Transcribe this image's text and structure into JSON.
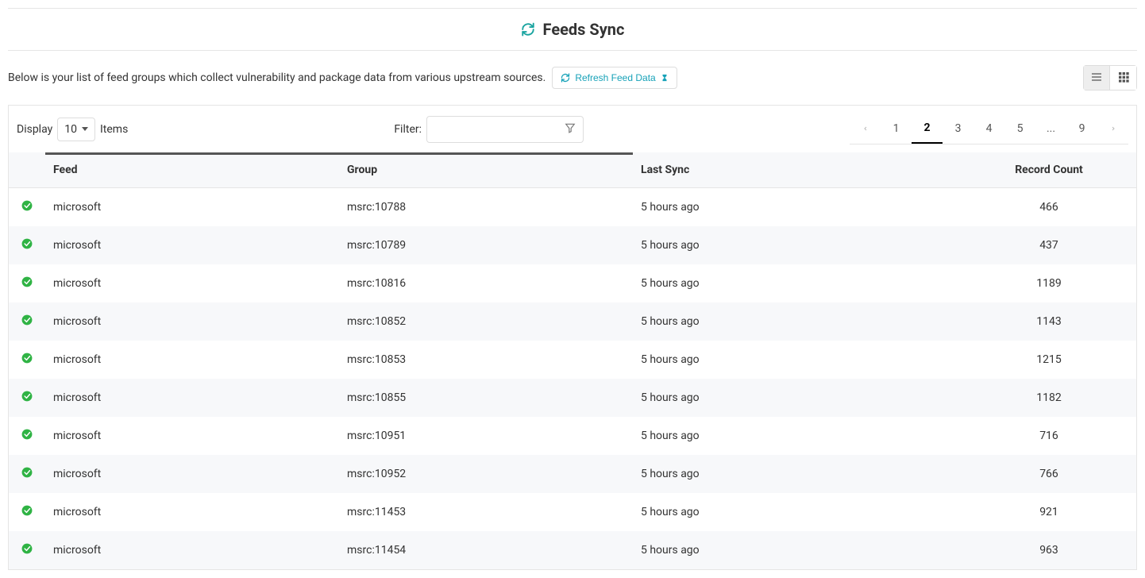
{
  "header": {
    "title": "Feeds Sync"
  },
  "subheader": {
    "description": "Below is your list of feed groups which collect vulnerability and package data from various upstream sources.",
    "refresh_label": "Refresh Feed Data"
  },
  "toolbar": {
    "display_label": "Display",
    "display_value": "10",
    "display_suffix": "Items",
    "filter_label": "Filter:",
    "filter_value": ""
  },
  "pagination": {
    "pages": [
      "1",
      "2",
      "3",
      "4",
      "5",
      "...",
      "9"
    ],
    "active": "2"
  },
  "table": {
    "headers": {
      "feed": "Feed",
      "group": "Group",
      "last_sync": "Last Sync",
      "record_count": "Record Count"
    },
    "rows": [
      {
        "feed": "microsoft",
        "group": "msrc:10788",
        "last_sync": "5 hours ago",
        "record_count": "466"
      },
      {
        "feed": "microsoft",
        "group": "msrc:10789",
        "last_sync": "5 hours ago",
        "record_count": "437"
      },
      {
        "feed": "microsoft",
        "group": "msrc:10816",
        "last_sync": "5 hours ago",
        "record_count": "1189"
      },
      {
        "feed": "microsoft",
        "group": "msrc:10852",
        "last_sync": "5 hours ago",
        "record_count": "1143"
      },
      {
        "feed": "microsoft",
        "group": "msrc:10853",
        "last_sync": "5 hours ago",
        "record_count": "1215"
      },
      {
        "feed": "microsoft",
        "group": "msrc:10855",
        "last_sync": "5 hours ago",
        "record_count": "1182"
      },
      {
        "feed": "microsoft",
        "group": "msrc:10951",
        "last_sync": "5 hours ago",
        "record_count": "716"
      },
      {
        "feed": "microsoft",
        "group": "msrc:10952",
        "last_sync": "5 hours ago",
        "record_count": "766"
      },
      {
        "feed": "microsoft",
        "group": "msrc:11453",
        "last_sync": "5 hours ago",
        "record_count": "921"
      },
      {
        "feed": "microsoft",
        "group": "msrc:11454",
        "last_sync": "5 hours ago",
        "record_count": "963"
      }
    ]
  }
}
